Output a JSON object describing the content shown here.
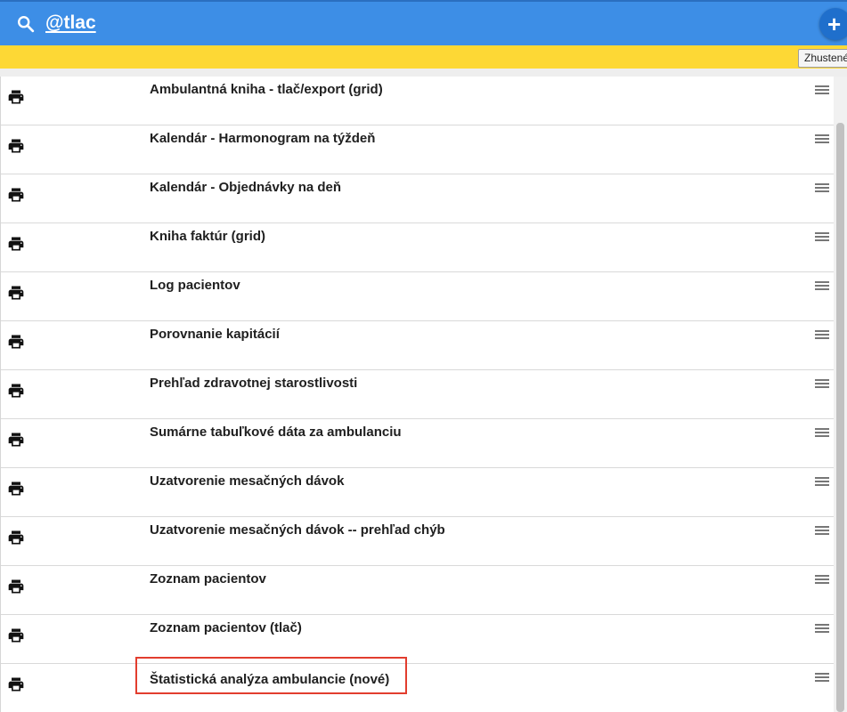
{
  "search": {
    "query": "@tlac"
  },
  "toolbar": {
    "add_label": "+",
    "compact_label": "Zhustené"
  },
  "items": [
    {
      "title": "Ambulantná kniha - tlač/export (grid)"
    },
    {
      "title": "Kalendár - Harmonogram na týždeň"
    },
    {
      "title": "Kalendár - Objednávky na deň"
    },
    {
      "title": "Kniha faktúr (grid)"
    },
    {
      "title": "Log pacientov"
    },
    {
      "title": "Porovnanie kapitácií"
    },
    {
      "title": "Prehľad zdravotnej starostlivosti"
    },
    {
      "title": "Sumárne tabuľkové dáta za ambulanciu"
    },
    {
      "title": "Uzatvorenie mesačných dávok"
    },
    {
      "title": "Uzatvorenie mesačných dávok -- prehľad chýb"
    },
    {
      "title": "Zoznam pacientov"
    },
    {
      "title": "Zoznam pacientov (tlač)"
    },
    {
      "title": "Štatistická analýza ambulancie (nové)"
    }
  ],
  "icons": {
    "row_icon": "printer-icon",
    "row_menu": "drag-handle-icon",
    "search": "search-icon"
  },
  "colors": {
    "header": "#3d8ee6",
    "notice_bar": "#fdd835",
    "highlight": "#e23d2e"
  }
}
